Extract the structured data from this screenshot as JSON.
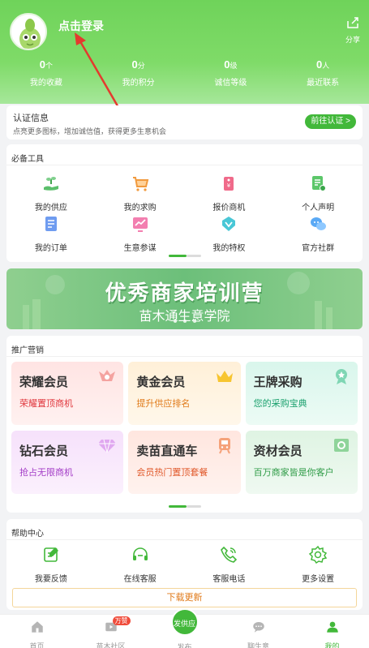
{
  "header": {
    "login_text": "点击登录",
    "share_label": "分享",
    "stats": [
      {
        "value": "0",
        "unit": "个",
        "label": "我的收藏"
      },
      {
        "value": "0",
        "unit": "分",
        "label": "我的积分"
      },
      {
        "value": "0",
        "unit": "级",
        "label": "诚信等级"
      },
      {
        "value": "0",
        "unit": "人",
        "label": "最近联系"
      }
    ]
  },
  "cert": {
    "title": "认证信息",
    "desc": "点亮更多图标，增加诚信值，获得更多生意机会",
    "button": "前往认证 >"
  },
  "tools": {
    "title": "必备工具",
    "items": [
      {
        "label": "我的供应",
        "icon": "hand-seedling-icon"
      },
      {
        "label": "我的求购",
        "icon": "cart-icon"
      },
      {
        "label": "报价商机",
        "icon": "price-tag-icon"
      },
      {
        "label": "个人声明",
        "icon": "document-icon"
      },
      {
        "label": "我的订单",
        "icon": "order-icon"
      },
      {
        "label": "生意参谋",
        "icon": "trend-chart-icon"
      },
      {
        "label": "我的特权",
        "icon": "privilege-icon"
      },
      {
        "label": "官方社群",
        "icon": "chat-group-icon"
      }
    ]
  },
  "banner": {
    "title": "优秀商家培训营",
    "subtitle": "苗木通生意学院"
  },
  "promo": {
    "title": "推广营销",
    "items": [
      {
        "title": "荣耀会员",
        "subtitle": "荣耀置顶商机"
      },
      {
        "title": "黄金会员",
        "subtitle": "提升供应排名"
      },
      {
        "title": "王牌采购",
        "subtitle": "您的采购宝典"
      },
      {
        "title": "钻石会员",
        "subtitle": "抢占无限商机"
      },
      {
        "title": "卖苗直通车",
        "subtitle": "会员热门置顶套餐"
      },
      {
        "title": "资材会员",
        "subtitle": "百万商家皆是你客户"
      }
    ]
  },
  "help": {
    "title": "帮助中心",
    "items": [
      {
        "label": "我要反馈",
        "icon": "feedback-icon"
      },
      {
        "label": "在线客服",
        "icon": "headset-icon"
      },
      {
        "label": "客服电话",
        "icon": "phone-icon"
      },
      {
        "label": "更多设置",
        "icon": "gear-icon"
      }
    ],
    "download": "下载更新"
  },
  "tabbar": {
    "items": [
      {
        "label": "首页",
        "icon": "home-icon"
      },
      {
        "label": "苗木社区",
        "icon": "video-icon",
        "badge": "万赞"
      },
      {
        "label": "发布",
        "icon": "publish-icon",
        "button": "发供应"
      },
      {
        "label": "聊生意",
        "icon": "message-icon"
      },
      {
        "label": "我的",
        "icon": "user-icon"
      }
    ]
  },
  "colors": {
    "brand_green": "#42b83a",
    "header_green": "#6fd35a",
    "accent_orange": "#e07a1a"
  }
}
